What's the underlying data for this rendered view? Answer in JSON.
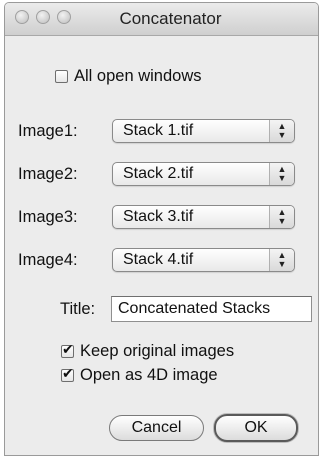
{
  "window": {
    "title": "Concatenator"
  },
  "all_open": {
    "label": "All open windows",
    "checked": false
  },
  "images": [
    {
      "label": "Image1:",
      "value": "Stack 1.tif"
    },
    {
      "label": "Image2:",
      "value": "Stack 2.tif"
    },
    {
      "label": "Image3:",
      "value": "Stack 3.tif"
    },
    {
      "label": "Image4:",
      "value": "Stack 4.tif"
    }
  ],
  "title_field": {
    "label": "Title:",
    "value": "Concatenated Stacks"
  },
  "options": [
    {
      "label": "Keep original images",
      "checked": true
    },
    {
      "label": "Open as 4D image",
      "checked": true
    }
  ],
  "buttons": {
    "cancel": "Cancel",
    "ok": "OK"
  },
  "icons": {
    "close": "close-icon",
    "minimize": "minimize-icon",
    "zoom": "zoom-icon",
    "dropdown": "chevron-updown-icon"
  }
}
